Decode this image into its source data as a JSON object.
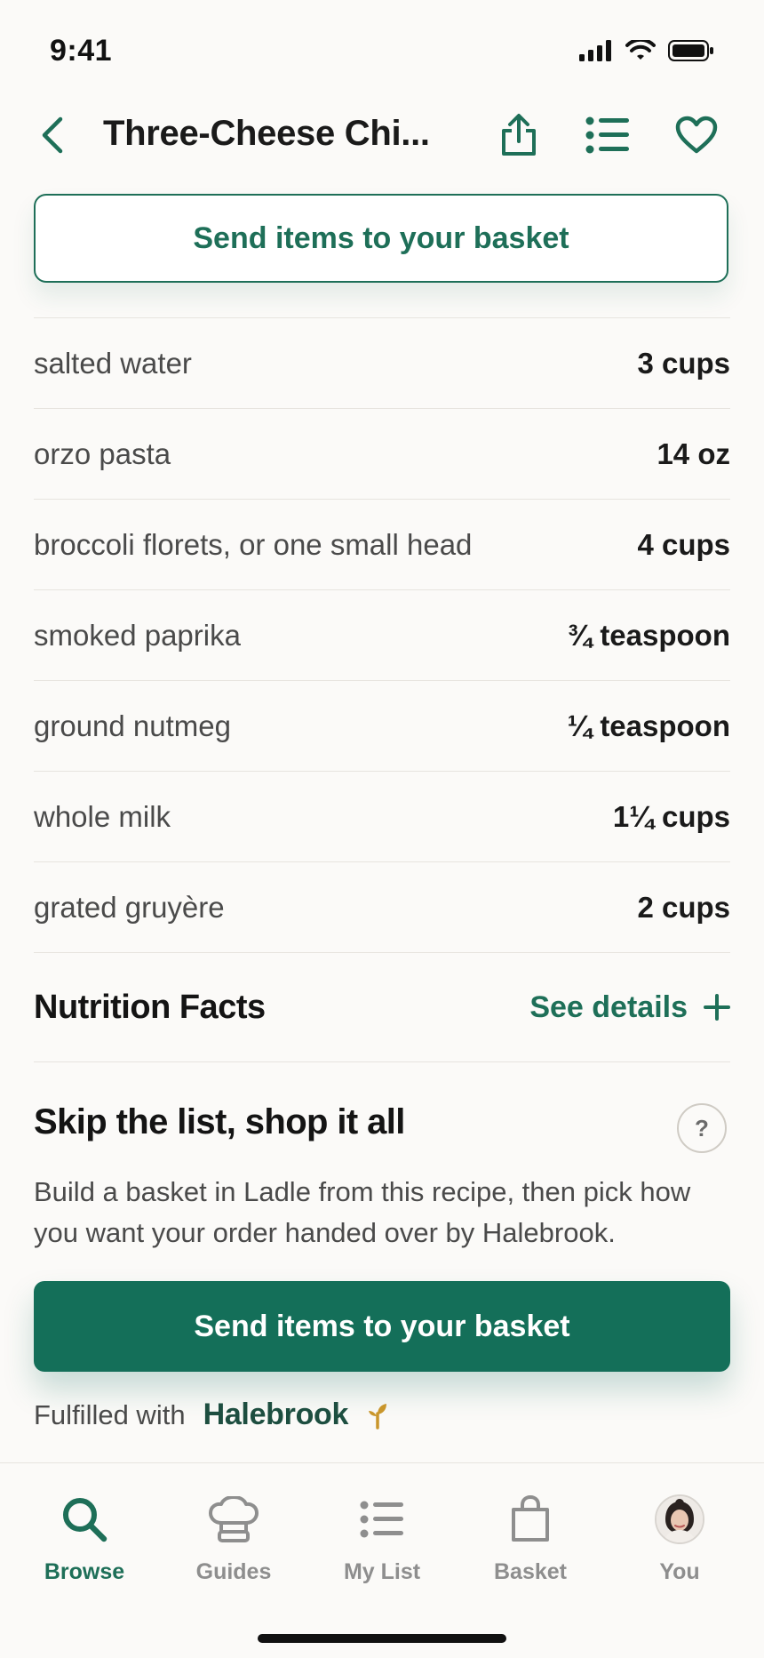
{
  "status_bar": {
    "time": "9:41"
  },
  "nav": {
    "title": "Three-Cheese Chi...",
    "icons": [
      "back-icon",
      "share-icon",
      "list-icon",
      "heart-icon"
    ]
  },
  "top_button": {
    "label": "Send items to your basket"
  },
  "ingredients": [
    {
      "name": "salted water",
      "amount": "3 cups"
    },
    {
      "name": "orzo pasta",
      "amount": "14 oz"
    },
    {
      "name": "broccoli florets, or one small head",
      "amount": "4 cups"
    },
    {
      "name": "smoked paprika",
      "amount": "¾ teaspoon"
    },
    {
      "name": "ground nutmeg",
      "amount": "¼ teaspoon"
    },
    {
      "name": "whole milk",
      "amount": "1¼ cups"
    },
    {
      "name": "grated gruyère",
      "amount": "2 cups"
    }
  ],
  "nutrition": {
    "title": "Nutrition Facts",
    "link": "See details"
  },
  "skip_section": {
    "title": "Skip the list, shop it all",
    "help": "?",
    "body": "Build a basket in Ladle from this recipe, then pick how you want your order handed over by Halebrook.",
    "button": "Send items to your basket",
    "fulfilled_label": "Fulfilled with",
    "brand": "Halebrook"
  },
  "tabs": [
    {
      "label": "Browse",
      "icon": "search-icon",
      "active": true
    },
    {
      "label": "Guides",
      "icon": "chef-hat-icon",
      "active": false
    },
    {
      "label": "My List",
      "icon": "list-icon",
      "active": false
    },
    {
      "label": "Basket",
      "icon": "bag-icon",
      "active": false
    },
    {
      "label": "You",
      "icon": "avatar",
      "active": false
    }
  ],
  "colors": {
    "accent": "#1E6F58",
    "button_fill": "#146F59",
    "background": "#FBFAF8"
  }
}
